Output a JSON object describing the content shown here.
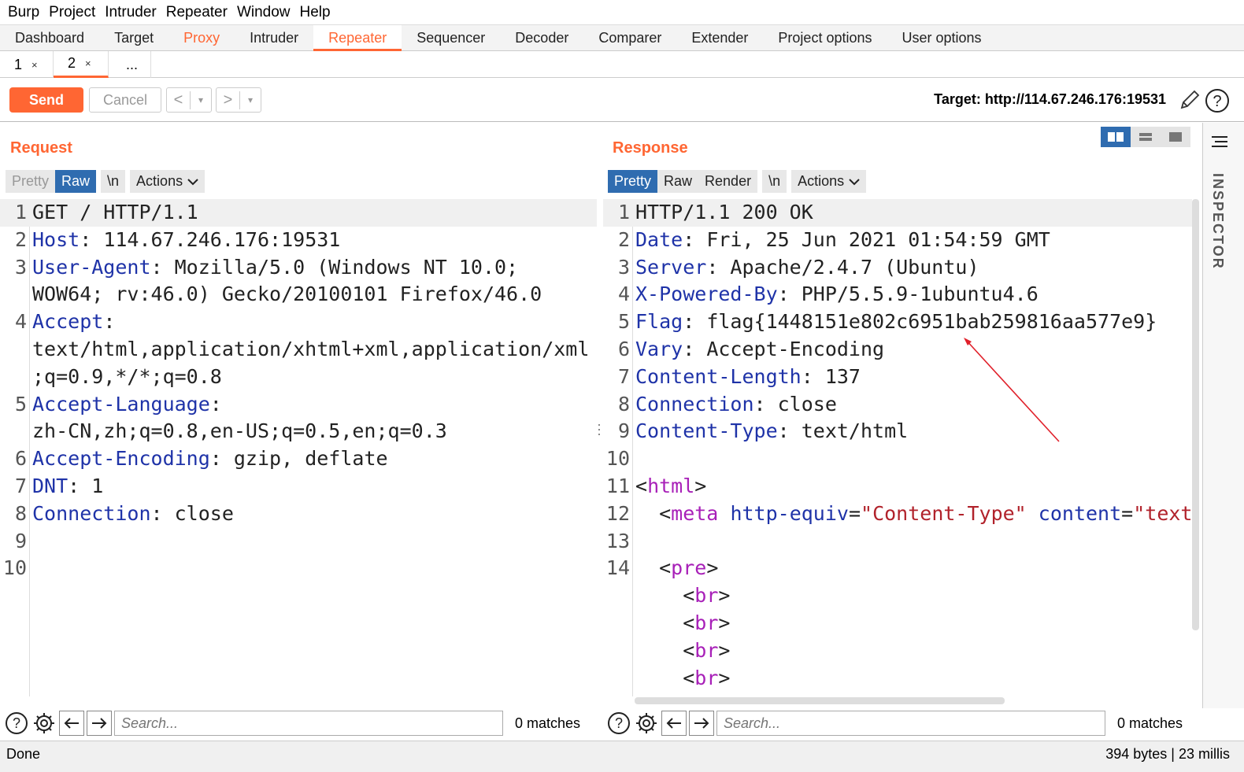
{
  "menubar": [
    "Burp",
    "Project",
    "Intruder",
    "Repeater",
    "Window",
    "Help"
  ],
  "tabs": [
    "Dashboard",
    "Target",
    "Proxy",
    "Intruder",
    "Repeater",
    "Sequencer",
    "Decoder",
    "Comparer",
    "Extender",
    "Project options",
    "User options"
  ],
  "subtabs": [
    {
      "label": "1",
      "close": "×"
    },
    {
      "label": "2",
      "close": "×"
    },
    {
      "label": "..."
    }
  ],
  "toolbar": {
    "send": "Send",
    "cancel": "Cancel",
    "back": "<",
    "forward": ">",
    "dropdown": "▾",
    "target": "Target: http://114.67.246.176:19531"
  },
  "request": {
    "title": "Request",
    "buttons": {
      "pretty": "Pretty",
      "raw": "Raw",
      "newline": "\\n",
      "actions": "Actions"
    },
    "lines": [
      {
        "n": "1",
        "parts": [
          {
            "c": "v",
            "t": "GET / HTTP/1.1"
          }
        ]
      },
      {
        "n": "2",
        "parts": [
          {
            "c": "k",
            "t": "Host"
          },
          {
            "c": "v",
            "t": ": 114.67.246.176:19531"
          }
        ]
      },
      {
        "n": "3",
        "parts": [
          {
            "c": "k",
            "t": "User-Agent"
          },
          {
            "c": "v",
            "t": ": Mozilla/5.0 (Windows NT 10.0;"
          }
        ]
      },
      {
        "n": "",
        "parts": [
          {
            "c": "v",
            "t": "WOW64; rv:46.0) Gecko/20100101 Firefox/46.0"
          }
        ]
      },
      {
        "n": "4",
        "parts": [
          {
            "c": "k",
            "t": "Accept"
          },
          {
            "c": "v",
            "t": ":"
          }
        ]
      },
      {
        "n": "",
        "parts": [
          {
            "c": "v",
            "t": "text/html,application/xhtml+xml,application/xml"
          }
        ]
      },
      {
        "n": "",
        "parts": [
          {
            "c": "v",
            "t": ";q=0.9,*/*;q=0.8"
          }
        ]
      },
      {
        "n": "5",
        "parts": [
          {
            "c": "k",
            "t": "Accept-Language"
          },
          {
            "c": "v",
            "t": ":"
          }
        ]
      },
      {
        "n": "",
        "parts": [
          {
            "c": "v",
            "t": "zh-CN,zh;q=0.8,en-US;q=0.5,en;q=0.3"
          }
        ]
      },
      {
        "n": "6",
        "parts": [
          {
            "c": "k",
            "t": "Accept-Encoding"
          },
          {
            "c": "v",
            "t": ": gzip, deflate"
          }
        ]
      },
      {
        "n": "7",
        "parts": [
          {
            "c": "k",
            "t": "DNT"
          },
          {
            "c": "v",
            "t": ": 1"
          }
        ]
      },
      {
        "n": "8",
        "parts": [
          {
            "c": "k",
            "t": "Connection"
          },
          {
            "c": "v",
            "t": ": close"
          }
        ]
      },
      {
        "n": "9",
        "parts": []
      },
      {
        "n": "10",
        "parts": []
      }
    ],
    "search_placeholder": "Search...",
    "matches": "0 matches"
  },
  "response": {
    "title": "Response",
    "buttons": {
      "pretty": "Pretty",
      "raw": "Raw",
      "render": "Render",
      "newline": "\\n",
      "actions": "Actions"
    },
    "lines": [
      {
        "n": "1",
        "parts": [
          {
            "c": "v",
            "t": "HTTP/1.1 200 OK"
          }
        ]
      },
      {
        "n": "2",
        "parts": [
          {
            "c": "k",
            "t": "Date"
          },
          {
            "c": "v",
            "t": ": Fri, 25 Jun 2021 01:54:59 GMT"
          }
        ]
      },
      {
        "n": "3",
        "parts": [
          {
            "c": "k",
            "t": "Server"
          },
          {
            "c": "v",
            "t": ": Apache/2.4.7 (Ubuntu)"
          }
        ]
      },
      {
        "n": "4",
        "parts": [
          {
            "c": "k",
            "t": "X-Powered-By"
          },
          {
            "c": "v",
            "t": ": PHP/5.5.9-1ubuntu4.6"
          }
        ]
      },
      {
        "n": "5",
        "parts": [
          {
            "c": "k",
            "t": "Flag"
          },
          {
            "c": "v",
            "t": ": flag{1448151e802c6951bab259816aa577e9}"
          }
        ]
      },
      {
        "n": "6",
        "parts": [
          {
            "c": "k",
            "t": "Vary"
          },
          {
            "c": "v",
            "t": ": Accept-Encoding"
          }
        ]
      },
      {
        "n": "7",
        "parts": [
          {
            "c": "k",
            "t": "Content-Length"
          },
          {
            "c": "v",
            "t": ": 137"
          }
        ]
      },
      {
        "n": "8",
        "parts": [
          {
            "c": "k",
            "t": "Connection"
          },
          {
            "c": "v",
            "t": ": close"
          }
        ]
      },
      {
        "n": "9",
        "parts": [
          {
            "c": "k",
            "t": "Content-Type"
          },
          {
            "c": "v",
            "t": ": text/html"
          }
        ]
      },
      {
        "n": "10",
        "parts": []
      },
      {
        "n": "11",
        "parts": [
          {
            "c": "v",
            "t": "<"
          },
          {
            "c": "tag",
            "t": "html"
          },
          {
            "c": "v",
            "t": ">"
          }
        ]
      },
      {
        "n": "12",
        "parts": [
          {
            "c": "v",
            "t": "  <"
          },
          {
            "c": "tag",
            "t": "meta"
          },
          {
            "c": "v",
            "t": " "
          },
          {
            "c": "attr",
            "t": "http-equiv"
          },
          {
            "c": "v",
            "t": "="
          },
          {
            "c": "str",
            "t": "\"Content-Type\""
          },
          {
            "c": "v",
            "t": " "
          },
          {
            "c": "attr",
            "t": "content"
          },
          {
            "c": "v",
            "t": "="
          },
          {
            "c": "str",
            "t": "\"text/"
          }
        ]
      },
      {
        "n": "13",
        "parts": []
      },
      {
        "n": "14",
        "parts": [
          {
            "c": "v",
            "t": "  <"
          },
          {
            "c": "tag",
            "t": "pre"
          },
          {
            "c": "v",
            "t": ">"
          }
        ]
      },
      {
        "n": "",
        "parts": [
          {
            "c": "v",
            "t": "    <"
          },
          {
            "c": "tag",
            "t": "br"
          },
          {
            "c": "v",
            "t": ">"
          }
        ]
      },
      {
        "n": "",
        "parts": [
          {
            "c": "v",
            "t": "    <"
          },
          {
            "c": "tag",
            "t": "br"
          },
          {
            "c": "v",
            "t": ">"
          }
        ]
      },
      {
        "n": "",
        "parts": [
          {
            "c": "v",
            "t": "    <"
          },
          {
            "c": "tag",
            "t": "br"
          },
          {
            "c": "v",
            "t": ">"
          }
        ]
      },
      {
        "n": "",
        "parts": [
          {
            "c": "v",
            "t": "    <"
          },
          {
            "c": "tag",
            "t": "br"
          },
          {
            "c": "v",
            "t": ">"
          }
        ]
      }
    ],
    "search_placeholder": "Search...",
    "matches": "0 matches"
  },
  "inspector": "INSPECTOR",
  "status": {
    "left": "Done",
    "right": "394 bytes | 23 millis"
  },
  "colors": {
    "accent": "#ff6633",
    "selected": "#2f6cb0",
    "header_key": "#1f33a8",
    "tag": "#a820b8",
    "string": "#b1222b",
    "annotation_arrow": "#e0202a"
  }
}
